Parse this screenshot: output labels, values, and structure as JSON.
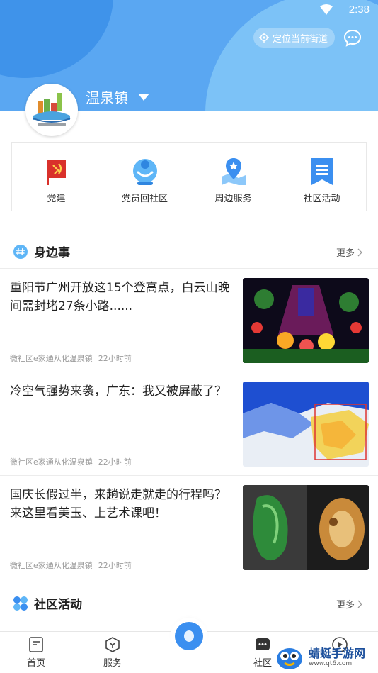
{
  "status_bar": {
    "time": "2:38"
  },
  "header": {
    "locate_label": "定位当前街道",
    "town_name": "温泉镇"
  },
  "quick_actions": [
    {
      "label": "党建",
      "icon": "party-flag-icon"
    },
    {
      "label": "党员回社区",
      "icon": "member-return-icon"
    },
    {
      "label": "周边服务",
      "icon": "map-pin-star-icon"
    },
    {
      "label": "社区活动",
      "icon": "activity-bookmark-icon"
    }
  ],
  "sections": {
    "nearby": {
      "title": "身边事",
      "more": "更多"
    },
    "activities": {
      "title": "社区活动",
      "more": "更多"
    }
  },
  "news": [
    {
      "title": "重阳节广州开放这15个登高点，白云山晚间需封堵27条小路......",
      "source": "微社区e家通从化温泉镇",
      "time": "22小时前"
    },
    {
      "title": "冷空气强势来袭，广东：我又被屏蔽了？",
      "source": "微社区e家通从化温泉镇",
      "time": "22小时前"
    },
    {
      "title": "国庆长假过半，来趟说走就走的行程吗？来这里看美玉、上艺术课吧！",
      "source": "微社区e家通从化温泉镇",
      "time": "22小时前"
    }
  ],
  "bottom_nav": [
    {
      "label": "首页",
      "icon": "home-doc-icon"
    },
    {
      "label": "服务",
      "icon": "service-icon"
    },
    {
      "label": "社区",
      "icon": "community-chat-icon"
    }
  ],
  "watermark": {
    "name": "蜻蜓手游网",
    "url": "www.qt6.com"
  },
  "colors": {
    "header_blue": "#5aa7f2",
    "accent_blue": "#3b8ff0",
    "party_red": "#d9312b"
  }
}
